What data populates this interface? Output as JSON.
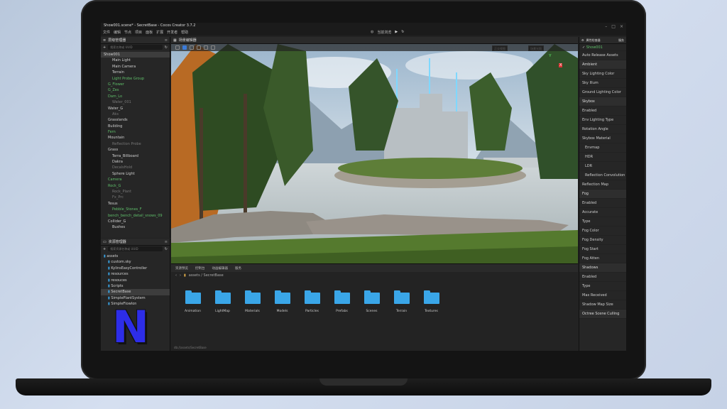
{
  "window": {
    "title": "Show001.scene* - SecretBase - Cocos Creator 3.7.2",
    "menu": [
      "文件",
      "编辑",
      "节点",
      "项目",
      "面板",
      "扩展",
      "开发者",
      "帮助"
    ],
    "preview_mode": "当前浏览"
  },
  "hierarchy": {
    "title": "层级管理器",
    "search_placeholder": "搜索名称或 UUID",
    "items": [
      {
        "label": "Show001",
        "style": "sel",
        "indent": 0
      },
      {
        "label": "Main Light",
        "style": "",
        "indent": 2
      },
      {
        "label": "Main Camera",
        "style": "",
        "indent": 2
      },
      {
        "label": "Terrain",
        "style": "",
        "indent": 2
      },
      {
        "label": "Light Probe Group",
        "style": "green",
        "indent": 2
      },
      {
        "label": "G_Flower",
        "style": "green",
        "indent": 1
      },
      {
        "label": "G_Zes",
        "style": "green",
        "indent": 1
      },
      {
        "label": "Dam_Lo",
        "style": "green",
        "indent": 1
      },
      {
        "label": "Water_001",
        "style": "dim",
        "indent": 2
      },
      {
        "label": "Water_G",
        "style": "",
        "indent": 1
      },
      {
        "label": "Aks",
        "style": "dim",
        "indent": 2
      },
      {
        "label": "Grasslands",
        "style": "",
        "indent": 1
      },
      {
        "label": "Building",
        "style": "",
        "indent": 1
      },
      {
        "label": "Fern",
        "style": "green",
        "indent": 1
      },
      {
        "label": "Mountain",
        "style": "",
        "indent": 1
      },
      {
        "label": "Reflection Probe",
        "style": "dim",
        "indent": 2
      },
      {
        "label": "Grass",
        "style": "",
        "indent": 1
      },
      {
        "label": "Terra_Billboard",
        "style": "",
        "indent": 2
      },
      {
        "label": "Dakra",
        "style": "",
        "indent": 2
      },
      {
        "label": "DecalsHold",
        "style": "dim",
        "indent": 2
      },
      {
        "label": "Sphere Light",
        "style": "",
        "indent": 2
      },
      {
        "label": "Camera",
        "style": "green",
        "indent": 1
      },
      {
        "label": "Rock_G",
        "style": "green",
        "indent": 1
      },
      {
        "label": "Rock_Plant",
        "style": "dim",
        "indent": 2
      },
      {
        "label": "Fx_Prc",
        "style": "dim",
        "indent": 2
      },
      {
        "label": "Tesus",
        "style": "",
        "indent": 1
      },
      {
        "label": "Pebble_Stones_F",
        "style": "green",
        "indent": 2
      },
      {
        "label": "bench_bench_detail_snows_09",
        "style": "green",
        "indent": 1
      },
      {
        "label": "Collider_G",
        "style": "",
        "indent": 1
      },
      {
        "label": "Bushes",
        "style": "",
        "indent": 2
      }
    ]
  },
  "assets": {
    "title": "资源管理器",
    "search_placeholder": "搜索资源名称或 UUID",
    "items": [
      {
        "label": "assets",
        "indent": 0,
        "sel": false
      },
      {
        "label": "custom.sky",
        "indent": 1,
        "sel": false
      },
      {
        "label": "KylinsEasyController",
        "indent": 1,
        "sel": false
      },
      {
        "label": "resources",
        "indent": 1,
        "sel": false
      },
      {
        "label": "resouces",
        "indent": 1,
        "sel": false
      },
      {
        "label": "Scripts",
        "indent": 1,
        "sel": false
      },
      {
        "label": "SecretBase",
        "indent": 1,
        "sel": true
      },
      {
        "label": "SimplePlantSystem",
        "indent": 1,
        "sel": false
      },
      {
        "label": "SimpleFlowlon",
        "indent": 1,
        "sel": false
      }
    ]
  },
  "scene": {
    "title": "场景编辑器",
    "chip_view": "正交视图",
    "chip_light": "场景光照",
    "gizmo_labels": {
      "y": "Y",
      "x": "X"
    }
  },
  "browser": {
    "tabs": [
      "资源预览",
      "控制台",
      "动画编辑器",
      "服务"
    ],
    "path": "assets / SecretBase",
    "folders": [
      "Animation",
      "LightMap",
      "Materials",
      "Models",
      "Particles",
      "Prefabs",
      "Scenes",
      "Terrain",
      "Textures"
    ],
    "footer": "db://assets/SecretBase"
  },
  "inspector": {
    "title": "属性检查器",
    "tab2": "服务",
    "node_name": "Show001",
    "rows": [
      {
        "label": "Auto Release Assets",
        "type": ""
      },
      {
        "label": "Ambient",
        "type": "section"
      },
      {
        "label": "Sky Lighting Color",
        "type": ""
      },
      {
        "label": "Sky Illum",
        "type": ""
      },
      {
        "label": "Ground Lighting Color",
        "type": ""
      },
      {
        "label": "Skybox",
        "type": "section"
      },
      {
        "label": "Enabled",
        "type": ""
      },
      {
        "label": "Env Lighting Type",
        "type": ""
      },
      {
        "label": "Rotation Angle",
        "type": ""
      },
      {
        "label": "Skybox Material",
        "type": ""
      },
      {
        "label": "Envmap",
        "type": "sub"
      },
      {
        "label": "HDR",
        "type": "sub"
      },
      {
        "label": "LDR",
        "type": "sub"
      },
      {
        "label": "Reflection Convolution",
        "type": "sub"
      },
      {
        "label": "Reflection Map",
        "type": ""
      },
      {
        "label": "Fog",
        "type": "section"
      },
      {
        "label": "Enabled",
        "type": ""
      },
      {
        "label": "Accurate",
        "type": ""
      },
      {
        "label": "Type",
        "type": ""
      },
      {
        "label": "Fog Color",
        "type": ""
      },
      {
        "label": "Fog Density",
        "type": ""
      },
      {
        "label": "Fog Start",
        "type": ""
      },
      {
        "label": "Fog Atten",
        "type": ""
      },
      {
        "label": "Shadows",
        "type": "section"
      },
      {
        "label": "Enabled",
        "type": ""
      },
      {
        "label": "Type",
        "type": ""
      },
      {
        "label": "Max Received",
        "type": ""
      },
      {
        "label": "Shadow Map Size",
        "type": ""
      },
      {
        "label": "Octree Scene Culling",
        "type": "section"
      }
    ]
  },
  "logo": {
    "letter": "N",
    "color": "#2d2de8"
  }
}
